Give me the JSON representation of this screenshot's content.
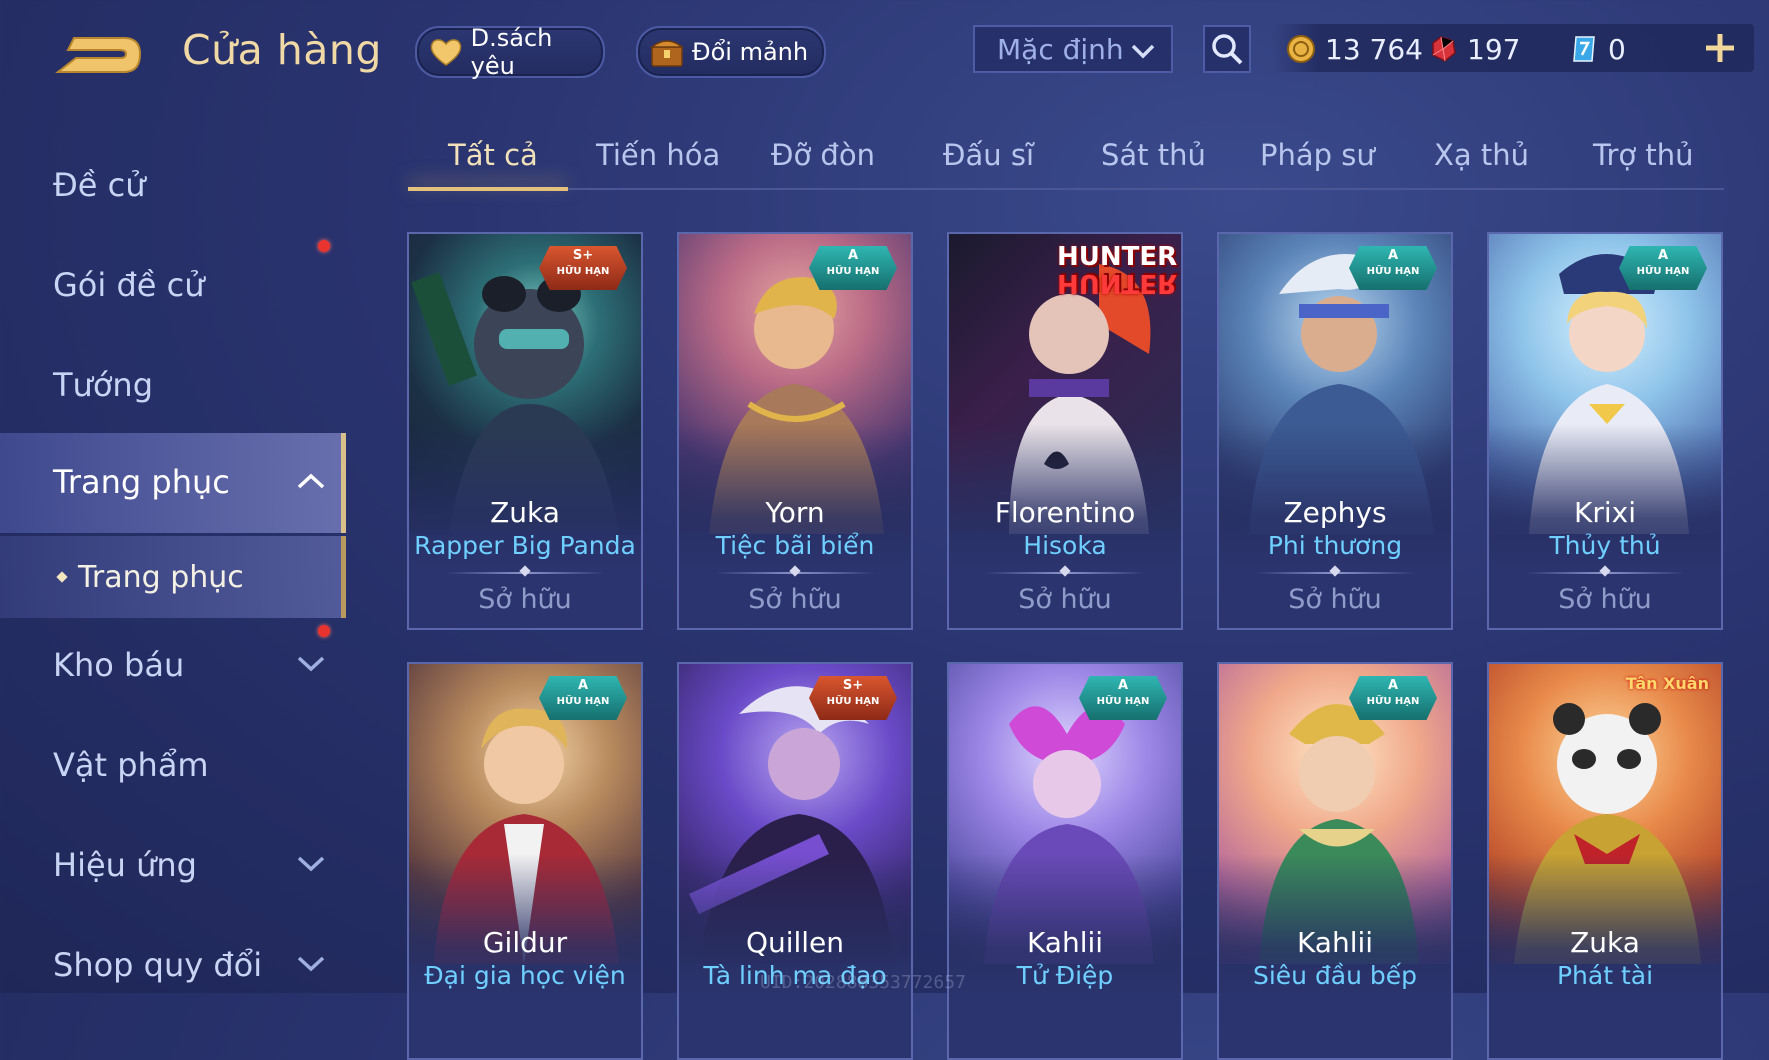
{
  "header": {
    "title": "Cửa hàng",
    "wishlist_label": "D.sách yêu",
    "exchange_label": "Đổi mảnh",
    "sort_value": "Mặc định",
    "currencies": [
      {
        "name": "gold",
        "value": "13 764"
      },
      {
        "name": "ruby",
        "value": "197"
      },
      {
        "name": "voucher",
        "value": "0"
      }
    ]
  },
  "sidebar": {
    "items": [
      {
        "label": "Đề cử"
      },
      {
        "label": "Gói đề cử"
      },
      {
        "label": "Tướng"
      },
      {
        "label": "Trang phục"
      },
      {
        "label": "Kho báu"
      },
      {
        "label": "Vật phẩm"
      },
      {
        "label": "Hiệu ứng"
      },
      {
        "label": "Shop quy đổi"
      }
    ],
    "sub_item": "Trang phục"
  },
  "tabs": [
    "Tất cả",
    "Tiến hóa",
    "Đỡ đòn",
    "Đấu sĩ",
    "Sát thủ",
    "Pháp sư",
    "Xạ thủ",
    "Trợ thủ"
  ],
  "cards": [
    {
      "hero": "Zuka",
      "skin": "Rapper Big Panda",
      "status": "Sở hữu",
      "badge_grade": "S+",
      "badge_text": "HỮU HẠN"
    },
    {
      "hero": "Yorn",
      "skin": "Tiệc bãi biển",
      "status": "Sở hữu",
      "badge_grade": "A",
      "badge_text": "HỮU HẠN"
    },
    {
      "hero": "Florentino",
      "skin": "Hisoka",
      "status": "Sở hữu",
      "badge_grade": "",
      "badge_text": "",
      "collab_top": "HUNTER",
      "collab_bottom": "HUNTER"
    },
    {
      "hero": "Zephys",
      "skin": "Phi thương",
      "status": "Sở hữu",
      "badge_grade": "A",
      "badge_text": "HỮU HẠN"
    },
    {
      "hero": "Krixi",
      "skin": "Thủy thủ",
      "status": "Sở hữu",
      "badge_grade": "A",
      "badge_text": "HỮU HẠN"
    },
    {
      "hero": "Gildur",
      "skin": "Đại gia học viện",
      "status": "",
      "badge_grade": "A",
      "badge_text": "HỮU HẠN"
    },
    {
      "hero": "Quillen",
      "skin": "Tà linh ma đạo",
      "status": "",
      "badge_grade": "S+",
      "badge_text": "HỮU HẠN"
    },
    {
      "hero": "Kahlii",
      "skin": "Tử Điệp",
      "status": "",
      "badge_grade": "A",
      "badge_text": "HỮU HẠN"
    },
    {
      "hero": "Kahlii",
      "skin": "Siêu đầu bếp",
      "status": "",
      "badge_grade": "A",
      "badge_text": "HỮU HẠN"
    },
    {
      "hero": "Zuka",
      "skin": "Phát tài",
      "status": "",
      "badge_grade": "",
      "badge_text": "",
      "event_tag": "Tân Xuân"
    }
  ],
  "watermark": "UID:202888353772657",
  "colors": {
    "accent": "#e4c27e",
    "skin_name": "#6fd0ff",
    "notify": "#e8332e"
  }
}
